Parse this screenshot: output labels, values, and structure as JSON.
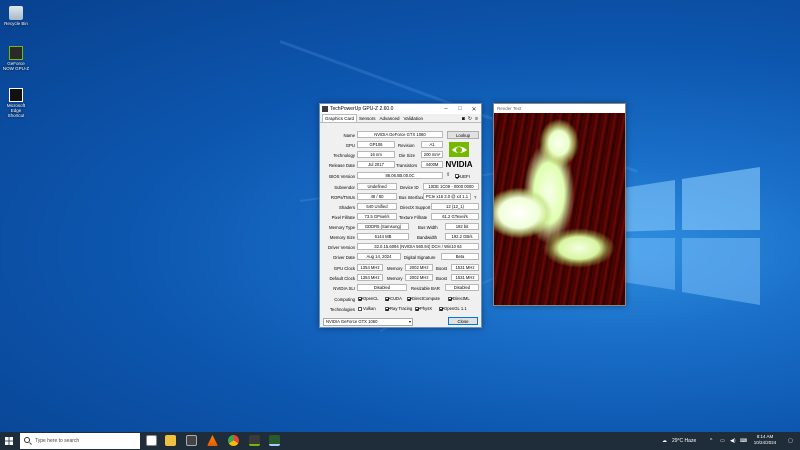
{
  "desktop": {
    "icons": [
      {
        "label": "Recycle Bin"
      },
      {
        "label": "GeForce NOW GPU-Z"
      },
      {
        "label": "Microsoft Edge Shortcut"
      }
    ]
  },
  "gpuz": {
    "title": "TechPowerUp GPU-Z 2.60.0",
    "tabs": [
      "Graphics Card",
      "Sensors",
      "Advanced",
      "Validation"
    ],
    "name_label": "Name",
    "name": "NVIDIA GeForce GTX 1060",
    "lookup": "Lookup",
    "gpu_label": "GPU",
    "gpu": "GP106",
    "revision_label": "Revision",
    "revision": "A1",
    "tech_label": "Technology",
    "tech": "16 nm",
    "diesize_label": "Die Size",
    "diesize": "200 mm²",
    "release_label": "Release Date",
    "release": "Jul 2017",
    "transistors_label": "Transistors",
    "transistors": "4400M",
    "bios_label": "BIOS Version",
    "bios": "86.06.5B.00.0C",
    "uefi_label": "UEFI",
    "subvendor_label": "Subvendor",
    "subvendor": "Undefined",
    "deviceid_label": "Device ID",
    "deviceid": "10DE 1C09 - 0000 0000",
    "rops_label": "ROPs/TMUs",
    "rops": "48 / 80",
    "bus_label": "Bus Interface",
    "bus": "PCIe x16 3.0 @ x4 1.1",
    "shaders_label": "Shaders",
    "shaders": "640 Unified",
    "dx_label": "DirectX Support",
    "dx": "12 (12_1)",
    "pixel_label": "Pixel Fillrate",
    "pixel": "73.5 GPixel/s",
    "texture_label": "Texture Fillrate",
    "texture": "61.2 GTexel/s",
    "memtype_label": "Memory Type",
    "memtype": "GDDR5 (Samsung)",
    "buswidth_label": "Bus Width",
    "buswidth": "192 bit",
    "memsize_label": "Memory Size",
    "memsize": "6144 MB",
    "bandwidth_label": "Bandwidth",
    "bandwidth": "192.2 GB/s",
    "driver_label": "Driver Version",
    "driver": "32.0.15.6094 (NVIDIA 560.94) DCH / Win10 64",
    "driverdate_label": "Driver Date",
    "driverdate": "Aug 14, 2024",
    "digsig_label": "Digital Signature",
    "digsig": "Beta",
    "gpuclock_label": "GPU Clock",
    "gpuclock": "1354 MHz",
    "memory_label": "Memory",
    "gpumem": "2002 MHz",
    "boost_label": "Boost",
    "gpuboost": "1531 MHz",
    "defclock_label": "Default Clock",
    "defclock": "1354 MHz",
    "defmem": "2002 MHz",
    "defboost": "1531 MHz",
    "sli_label": "NVIDIA SLI",
    "sli": "Disabled",
    "rebar_label": "Resizable BAR",
    "rebar": "Disabled",
    "computing_label": "Computing",
    "computing": [
      "OpenCL",
      "CUDA",
      "DirectCompute",
      "DirectML"
    ],
    "tech2_label": "Technologies",
    "technologies": [
      "Vulkan",
      "Ray Tracing",
      "PhysX",
      "OpenGL 1.1"
    ],
    "selected_gpu": "NVIDIA GeForce GTX 1060",
    "close": "Close"
  },
  "render": {
    "title": "Render Test"
  },
  "taskbar": {
    "search_placeholder": "Type here to search",
    "weather": "29°C  Haze",
    "time": "8:14 AM",
    "date": "10/24/2024"
  },
  "colors": {
    "accent": "#0d57b0",
    "nvidia": "#76b900",
    "taskbar": "#1f2c3a"
  }
}
